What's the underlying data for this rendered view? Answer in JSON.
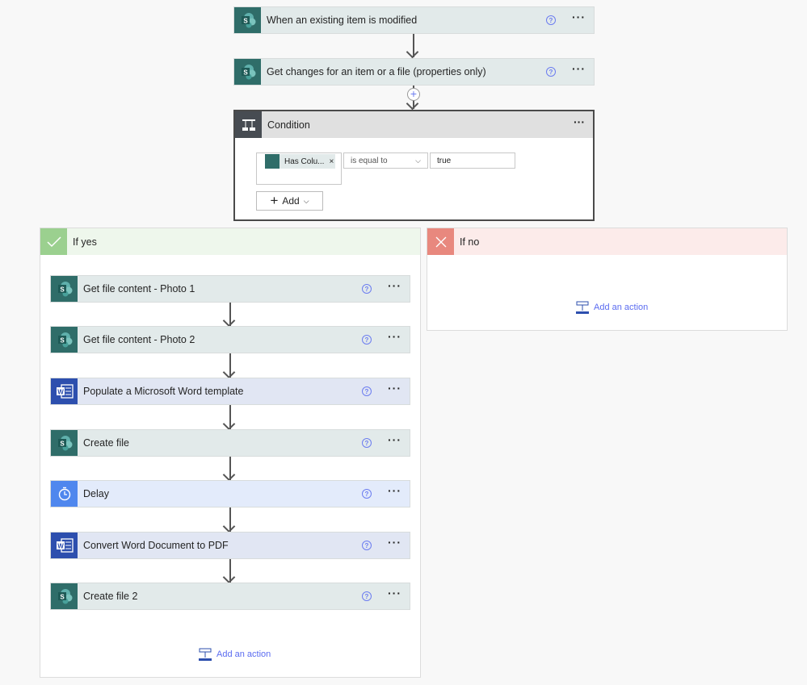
{
  "trigger": {
    "title": "When an existing item is modified",
    "icon": "sharepoint-icon"
  },
  "step2": {
    "title": "Get changes for an item or a file (properties only)",
    "icon": "sharepoint-icon"
  },
  "help_label": "?",
  "more_label": "···",
  "condition": {
    "title": "Condition",
    "token": "Has Colu...",
    "token_remove": "×",
    "operator": "is equal to",
    "value": "true",
    "add_label": "Add"
  },
  "if_yes": {
    "label": "If yes",
    "color": "#9bd08f",
    "actions": [
      {
        "title": "Get file content - Photo 1",
        "type": "sp"
      },
      {
        "title": "Get file content - Photo 2",
        "type": "sp"
      },
      {
        "title": "Populate a Microsoft Word template",
        "type": "wd"
      },
      {
        "title": "Create file",
        "type": "sp"
      },
      {
        "title": "Delay",
        "type": "dl"
      },
      {
        "title": "Convert Word Document to PDF",
        "type": "wd"
      },
      {
        "title": "Create file 2",
        "type": "sp"
      }
    ],
    "add_action": "Add an action"
  },
  "if_no": {
    "label": "If no",
    "color": "#e8887e",
    "add_action": "Add an action"
  }
}
